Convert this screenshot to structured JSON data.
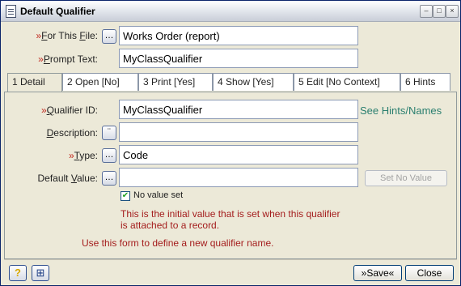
{
  "window": {
    "title": "Default Qualifier",
    "controls": [
      "–",
      "□",
      "×"
    ]
  },
  "header_form": {
    "for_file_label": "»For This File:",
    "for_file_value": "Works Order (report)",
    "prompt_label": "»Prompt Text:",
    "prompt_value": "MyClassQualifier"
  },
  "tabs": [
    {
      "label": "1 Detail",
      "active": true
    },
    {
      "label": "2 Open [No]"
    },
    {
      "label": "3 Print [Yes]"
    },
    {
      "label": "4 Show [Yes]"
    },
    {
      "label": "5 Edit [No Context]"
    },
    {
      "label": "6 Hints"
    }
  ],
  "detail": {
    "qualifier_id_label": "»Qualifier ID:",
    "qualifier_id_value": "MyClassQualifier",
    "hints_link": "See Hints/Names",
    "description_label": "Description:",
    "description_value": "",
    "type_label": "»Type:",
    "type_value": "Code",
    "default_value_label": "Default Value:",
    "default_value_value": "",
    "set_no_value_button": "Set No Value",
    "no_value_checkbox_label": "No value set",
    "no_value_checked": true,
    "note_line1": "This is the initial value that is set when this qualifier",
    "note_line2": "is attached to a record.",
    "form_help": "Use this form to define a new qualifier name."
  },
  "footer": {
    "help_icon": "question-icon",
    "binoculars_icon": "binoculars-icon",
    "save_label": "»Save«",
    "close_label": "Close"
  },
  "colors": {
    "required": "#c0281e",
    "note": "#a41d1d",
    "link": "#2a7f6f",
    "window_bg": "#ece9d8"
  }
}
